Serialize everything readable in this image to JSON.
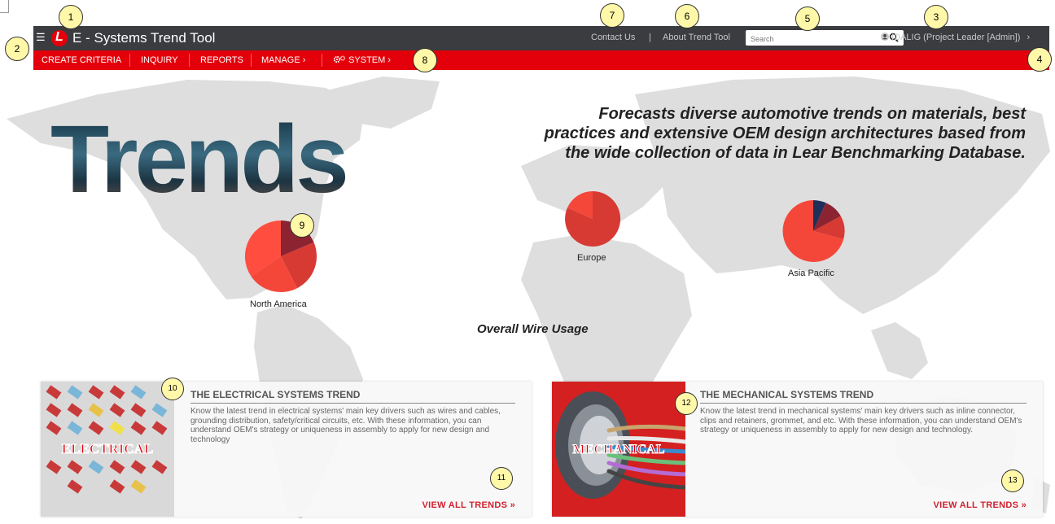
{
  "app": {
    "title": "E - Systems Trend Tool",
    "logo_letter": "L"
  },
  "topbar": {
    "menu_icon": "hamburger-icon",
    "contact_label": "Contact Us",
    "separator": "|",
    "about_label": "About Trend Tool",
    "search_placeholder": "Search",
    "search_icon": "magnifier-icon",
    "user_icon": "user-circle-icon",
    "user_label": "IDALIG (Project Leader [Admin])",
    "user_chevron": "›"
  },
  "nav": {
    "items": [
      {
        "label": "CREATE CRITERIA"
      },
      {
        "label": "INQUIRY"
      },
      {
        "label": "REPORTS"
      },
      {
        "label": "MANAGE ›"
      },
      {
        "label": "SYSTEM ›",
        "icon": "gears-icon"
      }
    ]
  },
  "hero": {
    "trends_word": "Trends",
    "headline": "Forecasts diverse automotive trends on materials, best practices and extensive OEM design architectures based from the wide collection of data in Lear Benchmarking Database."
  },
  "regions": [
    {
      "name": "North America"
    },
    {
      "name": "Europe"
    },
    {
      "name": "Asia Pacific"
    }
  ],
  "wire_caption": "Overall Wire Usage",
  "cards": [
    {
      "image_label": "ELECTRICAL",
      "title": "THE ELECTRICAL SYSTEMS TREND",
      "description": "Know the latest trend in electrical systems' main key drivers such as wires and cables, grounding distribution, safety/critical circuits, etc. With these information, you can understand OEM's strategy or uniqueness in assembly to apply for new design and technology",
      "link_label": "VIEW ALL TRENDS »"
    },
    {
      "image_label": "MECHANICAL",
      "title": "THE MECHANICAL SYSTEMS TREND",
      "description": "Know the latest trend in mechanical systems' main key drivers such as inline connector, clips and retainers, grommet, and etc. With these information, you can understand OEM's strategy or uniqueness in assembly to apply for new design and technology.",
      "link_label": "VIEW ALL TRENDS »"
    }
  ],
  "callouts": [
    "1",
    "2",
    "3",
    "4",
    "5",
    "6",
    "7",
    "8",
    "9",
    "10",
    "11",
    "12",
    "13"
  ],
  "colors": {
    "topbar": "#3a3c40",
    "navbar": "#e3000b",
    "accent": "#d0202e",
    "pie_light": "#f4473a",
    "pie_mid": "#d63a33",
    "pie_dark": "#8b2330",
    "pie_navy": "#1f2f5a"
  }
}
